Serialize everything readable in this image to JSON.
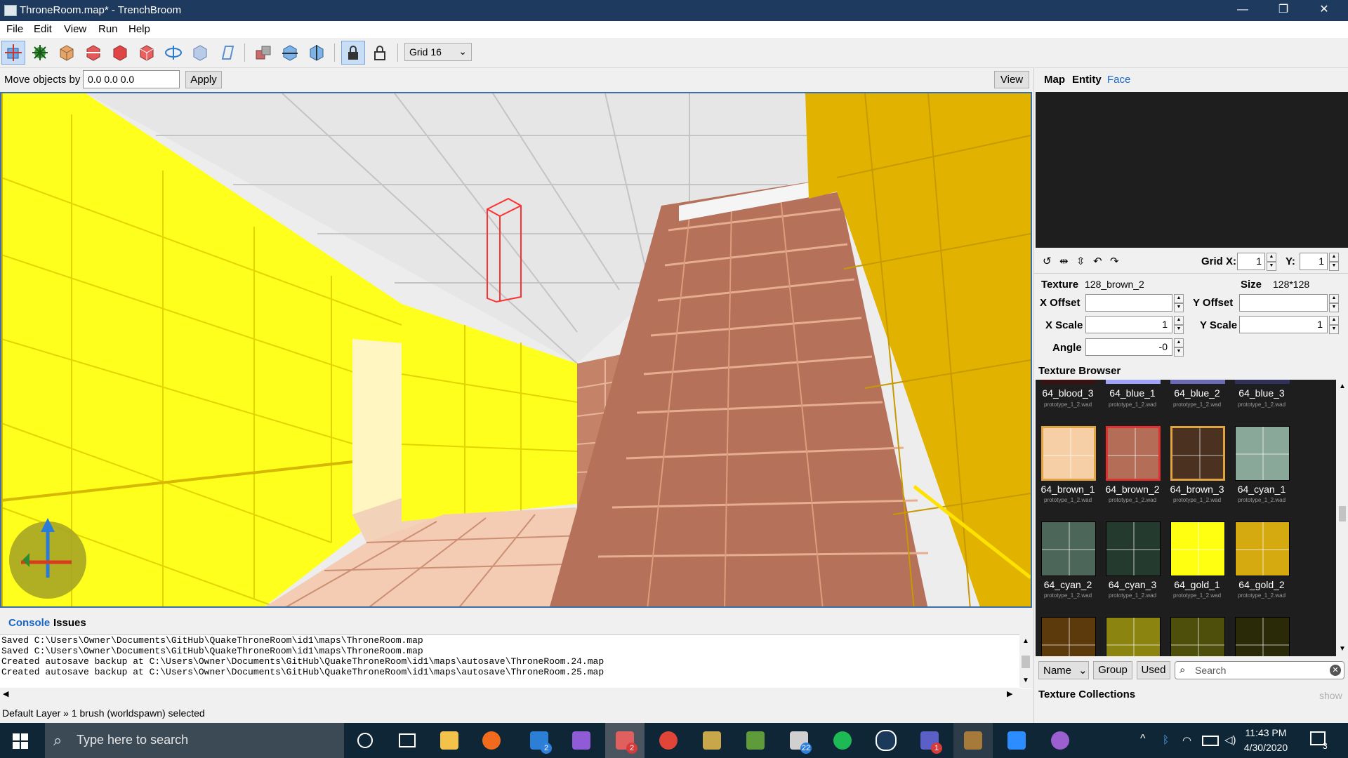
{
  "window": {
    "title": "ThroneRoom.map* - TrenchBroom",
    "minimize": "—",
    "restore": "❐",
    "close": "✕"
  },
  "menu": [
    "File",
    "Edit",
    "View",
    "Run",
    "Help"
  ],
  "toolbar": {
    "grid_value": "Grid 16"
  },
  "move_bar": {
    "label": "Move objects by",
    "value": "0.0 0.0 0.0",
    "apply": "Apply",
    "view_button": "View"
  },
  "inspector_tabs": [
    "Map",
    "Entity",
    "Face"
  ],
  "face": {
    "grid_x_label": "Grid X:",
    "grid_x": "1",
    "grid_y_label": "Y:",
    "grid_y": "1",
    "texture_label": "Texture",
    "texture_value": "128_brown_2",
    "size_label": "Size",
    "size_value": "128*128",
    "x_offset_label": "X Offset",
    "x_offset": "",
    "y_offset_label": "Y Offset",
    "y_offset": "",
    "x_scale_label": "X Scale",
    "x_scale": "1",
    "y_scale_label": "Y Scale",
    "y_scale": "1",
    "angle_label": "Angle",
    "angle": "-0"
  },
  "texture_browser": {
    "title": "Texture Browser",
    "partial_row": [
      "64_blood_3",
      "64_blue_1",
      "64_blue_2",
      "64_blue_3"
    ],
    "partial_sub": [
      "prototype_1_2.wad",
      "prototype_1_2.wad",
      "prototype_1_2.wad",
      "prototype_1_2.wad"
    ],
    "row1": [
      {
        "name": "64_brown_1",
        "sub": "prototype_1_2.wad",
        "color": "#f7cfa6"
      },
      {
        "name": "64_brown_2",
        "sub": "prototype_1_2.wad",
        "color": "#b46e57"
      },
      {
        "name": "64_brown_3",
        "sub": "prototype_1_2.wad",
        "color": "#4b3220"
      },
      {
        "name": "64_cyan_1",
        "sub": "prototype_1_2.wad",
        "color": "#8aa89a"
      }
    ],
    "row2": [
      {
        "name": "64_cyan_2",
        "sub": "prototype_1_2.wad",
        "color": "#4c6659"
      },
      {
        "name": "64_cyan_3",
        "sub": "prototype_1_2.wad",
        "color": "#253a2e"
      },
      {
        "name": "64_gold_1",
        "sub": "prototype_1_2.wad",
        "color": "#ffff12"
      },
      {
        "name": "64_gold_2",
        "sub": "prototype_1_2.wad",
        "color": "#d4aa10"
      }
    ],
    "row3_colors": [
      "#5c3a0c",
      "#8c8410",
      "#4f4f0c",
      "#2a2a08"
    ],
    "sort": "Name",
    "group": "Group",
    "used": "Used",
    "search_placeholder": "Search",
    "collections": "Texture Collections",
    "collections_toggle": "show"
  },
  "console": {
    "tabs": [
      "Console",
      "Issues"
    ],
    "lines": [
      "Saved C:\\Users\\Owner\\Documents\\GitHub\\QuakeThroneRoom\\id1\\maps\\ThroneRoom.map",
      "Saved C:\\Users\\Owner\\Documents\\GitHub\\QuakeThroneRoom\\id1\\maps\\ThroneRoom.map",
      "Created autosave backup at C:\\Users\\Owner\\Documents\\GitHub\\QuakeThroneRoom\\id1\\maps\\autosave\\ThroneRoom.24.map",
      "Created autosave backup at C:\\Users\\Owner\\Documents\\GitHub\\QuakeThroneRoom\\id1\\maps\\autosave\\ThroneRoom.25.map"
    ]
  },
  "status": "Default Layer » 1 brush (worldspawn) selected",
  "taskbar": {
    "search_placeholder": "Type here to search",
    "mail_badge": "2",
    "discord_badge": "2",
    "steam_badge": "22",
    "teams_badge": "1",
    "time": "11:43 PM",
    "date": "4/30/2020",
    "notif_count": "3"
  }
}
